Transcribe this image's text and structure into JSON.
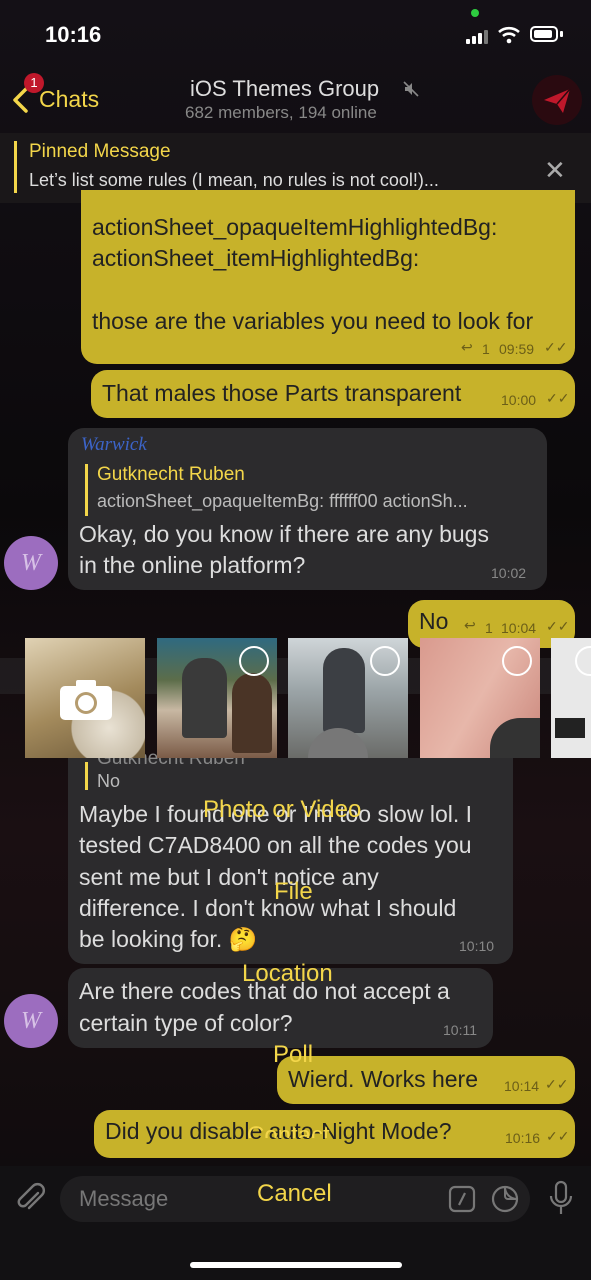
{
  "status": {
    "time": "10:16"
  },
  "nav": {
    "back_label": "Chats",
    "unread_badge": "1",
    "title": "iOS Themes Group",
    "subtitle": "682 members, 194 online"
  },
  "pinned": {
    "title": "Pinned Message",
    "text": "Let’s list some rules (I mean, no rules is not cool!)..."
  },
  "messages": {
    "m1": {
      "lines": [
        "actionSheet_opaqueItemHighlightedBg:",
        "actionSheet_itemHighlightedBg:",
        "",
        "those are the variables you need to look for"
      ],
      "replies": "1",
      "time": "09:59"
    },
    "m2": {
      "text": "That males those Parts transparent",
      "time": "10:00"
    },
    "m3": {
      "sender": "Warwick",
      "reply_name": "Gutknecht Ruben",
      "reply_text": "actionSheet_opaqueItemBg: ffffff00 actionSh...",
      "lines": [
        "Okay, do you know if there are any bugs",
        "in the online platform?"
      ],
      "time": "10:02"
    },
    "m4": {
      "text": "No",
      "replies": "1",
      "time": "10:04"
    },
    "m5": {
      "reply_name": "Gutknecht Ruben",
      "reply_text": "No",
      "lines": [
        "Maybe I found one or I'm too slow lol. I",
        "tested C7AD8400 on all the codes you",
        "sent me but I don't notice any",
        "difference. I don't know what I should",
        "be looking for. 🤔"
      ],
      "time": "10:10"
    },
    "m6": {
      "lines": [
        "Are there codes that do not accept a",
        "certain type of color?"
      ],
      "time": "10:11"
    },
    "m7": {
      "text": "Wierd. Works here",
      "time": "10:14"
    },
    "m8": {
      "text": "Did you disable auto-Night Mode?",
      "time": "10:16"
    }
  },
  "avatar_initial": "W",
  "attach_menu": {
    "items": [
      "Photo or Video",
      "File",
      "Location",
      "Poll",
      "Contact"
    ],
    "cancel": "Cancel"
  },
  "input": {
    "placeholder": "Message"
  },
  "colors": {
    "accent": "#f3d64a",
    "outgoing_bubble": "#c7b22a",
    "incoming_bubble": "#2c2b2d",
    "badge": "#c0182b"
  },
  "icons": {
    "attach": "paperclip-icon",
    "commands": "slash-command-icon",
    "sticker": "sticker-icon",
    "voice": "microphone-icon",
    "camera": "camera-icon"
  }
}
